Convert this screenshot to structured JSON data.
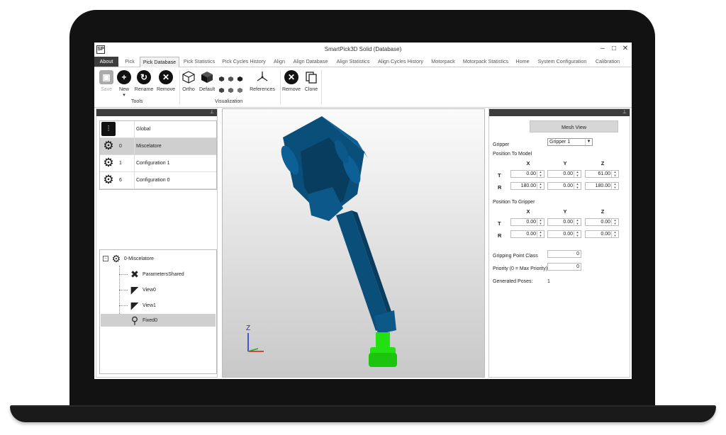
{
  "window": {
    "title": "SmartPick3D Solid (Database)",
    "app_icon": "app-icon",
    "min_icon": "–",
    "max_icon": "□",
    "close_icon": "✕"
  },
  "tabs": [
    "About",
    "Pick",
    "Pick Database",
    "Pick Statistics",
    "Pick Cycles History",
    "Align",
    "Align Database",
    "Align Statistics",
    "Align Cycles History",
    "Motorpack",
    "Motorpack Statistics",
    "Home",
    "System Configuration",
    "Calibration"
  ],
  "active_tab": "Pick Database",
  "ribbon": {
    "tools": {
      "label": "Tools",
      "save": "Save",
      "new": "New",
      "rename": "Rename",
      "remove": "Remove"
    },
    "visualization": {
      "label": "Visualization",
      "ortho": "Ortho",
      "default": "Default",
      "references": "References"
    },
    "other": {
      "remove": "Remove",
      "clone": "Clone"
    }
  },
  "configurations": [
    {
      "id": "",
      "name": "Global",
      "icon": "sliders-icon",
      "selected": false
    },
    {
      "id": "0",
      "name": "Miscelatore",
      "icon": "gear-icon",
      "selected": true
    },
    {
      "id": "1",
      "name": "Configuration 1",
      "icon": "gear-icon",
      "selected": false
    },
    {
      "id": "6",
      "name": "Configuration 0",
      "icon": "gear-icon",
      "selected": false
    }
  ],
  "tree": {
    "root": "0-Miscelatore",
    "children": [
      {
        "label": "ParametersShared",
        "icon": "tools-icon",
        "selected": false
      },
      {
        "label": "View0",
        "icon": "camera-icon",
        "selected": false
      },
      {
        "label": "View1",
        "icon": "camera-icon",
        "selected": false
      },
      {
        "label": "Fixed0",
        "icon": "gripper-icon",
        "selected": true
      }
    ]
  },
  "viewport": {
    "axis_label": "Z"
  },
  "properties": {
    "mesh_view": "Mesh View",
    "gripper_label": "Gripper",
    "gripper_value": "Gripper 1",
    "position_to_model": "Position To Model",
    "position_to_gripper": "Position To Gripper",
    "axes": [
      "X",
      "Y",
      "Z"
    ],
    "row_t": "T",
    "row_r": "R",
    "model_t": [
      "0.00",
      "0.00",
      "61.00"
    ],
    "model_r": [
      "180.00",
      "0.00",
      "180.00"
    ],
    "gripper_t": [
      "0.00",
      "0.00",
      "0.00"
    ],
    "gripper_r": [
      "0.00",
      "0.00",
      "0.00"
    ],
    "gripping_point_class_label": "Gripping Point Class",
    "gripping_point_class": "0",
    "priority_label": "Priority (0 = Max Priority):",
    "priority": "0",
    "generated_poses_label": "Generated Poses:",
    "generated_poses": "1"
  },
  "colors": {
    "model_blue": "#0a4f7a",
    "gripper_green": "#22e012",
    "head_dark": "#3d3d3d"
  }
}
